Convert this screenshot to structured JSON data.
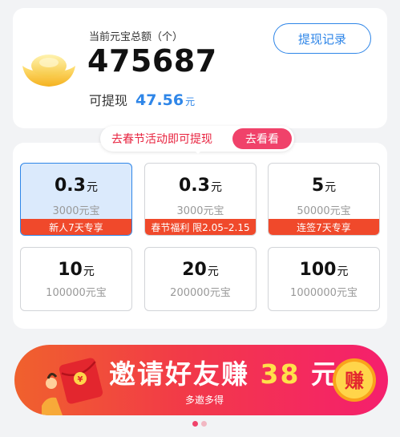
{
  "balance": {
    "total_label": "当前元宝总额（个）",
    "total_value": "475687",
    "withdraw_label": "可提现",
    "withdraw_amount": "47.56",
    "withdraw_unit": "元",
    "record_button": "提现记录"
  },
  "promo": {
    "text": "去春节活动即可提现",
    "button": "去看看"
  },
  "options": [
    {
      "amount": "0.3",
      "unit": "元",
      "coins": "3000元宝",
      "tag": "新人7天专享",
      "selected": true
    },
    {
      "amount": "0.3",
      "unit": "元",
      "coins": "3000元宝",
      "tag": "春节福利 限2.05–2.15",
      "selected": false
    },
    {
      "amount": "5",
      "unit": "元",
      "coins": "50000元宝",
      "tag": "连签7天专享",
      "selected": false
    },
    {
      "amount": "10",
      "unit": "元",
      "coins": "100000元宝",
      "tag": "",
      "selected": false
    },
    {
      "amount": "20",
      "unit": "元",
      "coins": "200000元宝",
      "tag": "",
      "selected": false
    },
    {
      "amount": "100",
      "unit": "元",
      "coins": "1000000元宝",
      "tag": "",
      "selected": false
    }
  ],
  "banner": {
    "title_prefix": "邀请好友赚",
    "title_amount": "38",
    "title_unit": "元",
    "subtitle": "多邀多得",
    "coin_text": "赚"
  },
  "icons": {
    "ingot": "gold-ingot-icon",
    "envelope": "red-envelope-icon",
    "coin": "earn-coin-icon"
  },
  "colors": {
    "accent_blue": "#2f86e8",
    "promo_red": "#e8233f",
    "tag_red": "#f0492b",
    "banner_yellow": "#ffe14a"
  },
  "carousel": {
    "total": 2,
    "active": 1
  }
}
